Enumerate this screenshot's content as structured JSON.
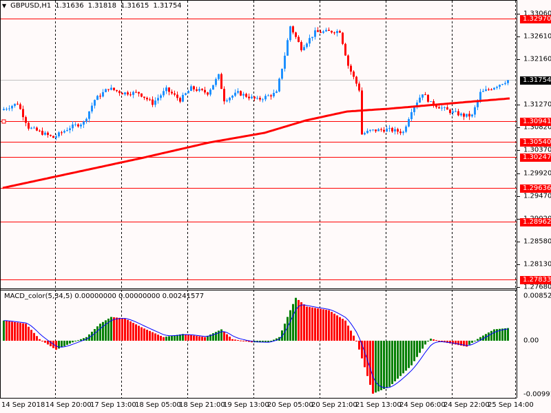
{
  "header": {
    "symbol": "GBPUSD,H1",
    "open": "1.31636",
    "high": "1.31818",
    "low": "1.31615",
    "close": "1.31754"
  },
  "macd_header": {
    "label": "MACD_color(5,34,5) 0.00000000 0.00000000 0.00241577"
  },
  "colors": {
    "up": "#1e90ff",
    "down": "#ff0000",
    "ma": "#ff0000",
    "level": "#ff0000",
    "macd_up": "#008000",
    "macd_down": "#ff0000",
    "signal": "#0000ff",
    "bid": "#c0c0c0"
  },
  "price_axis": [
    "1.33060",
    "1.32610",
    "1.32160",
    "1.31270",
    "1.30820",
    "1.30370",
    "1.29920",
    "1.29470",
    "1.29020",
    "1.28580",
    "1.28130",
    "1.27680"
  ],
  "levels": [
    {
      "value": "1.32970"
    },
    {
      "value": "1.30941"
    },
    {
      "value": "1.30540"
    },
    {
      "value": "1.30247"
    },
    {
      "value": "1.29636"
    },
    {
      "value": "1.28962"
    },
    {
      "value": "1.27833"
    }
  ],
  "bid": {
    "value": "1.31754"
  },
  "macd_axis": {
    "max": "0.008525",
    "zero": "0.00",
    "min": "-0.009915"
  },
  "time_axis": [
    "14 Sep 2018",
    "14 Sep 20:00",
    "17 Sep 13:00",
    "18 Sep 05:00",
    "18 Sep 21:00",
    "19 Sep 13:00",
    "20 Sep 05:00",
    "20 Sep 21:00",
    "21 Sep 13:00",
    "24 Sep 06:00",
    "24 Sep 22:00",
    "25 Sep 14:00"
  ],
  "chart_data": {
    "type": "candlestick",
    "symbol": "GBPUSD",
    "timeframe": "H1",
    "ylim": [
      1.2768,
      1.3306
    ],
    "bars": 184,
    "close_keypoints": [
      [
        0,
        1.31163
      ],
      [
        6,
        1.31298
      ],
      [
        10,
        1.30824
      ],
      [
        19,
        1.30621
      ],
      [
        25,
        1.30824
      ],
      [
        30,
        1.30919
      ],
      [
        34,
        1.31366
      ],
      [
        39,
        1.31596
      ],
      [
        44,
        1.31502
      ],
      [
        50,
        1.31502
      ],
      [
        55,
        1.31298
      ],
      [
        60,
        1.31569
      ],
      [
        65,
        1.31366
      ],
      [
        69,
        1.31596
      ],
      [
        75,
        1.31502
      ],
      [
        79,
        1.3184
      ],
      [
        81,
        1.31366
      ],
      [
        86,
        1.31502
      ],
      [
        93,
        1.31366
      ],
      [
        100,
        1.31502
      ],
      [
        103,
        1.32247
      ],
      [
        105,
        1.32816
      ],
      [
        109,
        1.32382
      ],
      [
        114,
        1.32694
      ],
      [
        123,
        1.32721
      ],
      [
        126,
        1.32044
      ],
      [
        130,
        1.31569
      ],
      [
        131,
        1.30688
      ],
      [
        134,
        1.30756
      ],
      [
        140,
        1.30783
      ],
      [
        146,
        1.30729
      ],
      [
        149,
        1.31163
      ],
      [
        153,
        1.31502
      ],
      [
        156,
        1.31298
      ],
      [
        163,
        1.31136
      ],
      [
        168,
        1.31054
      ],
      [
        171,
        1.31054
      ],
      [
        174,
        1.31502
      ],
      [
        178,
        1.31596
      ],
      [
        184,
        1.31754
      ]
    ],
    "ma_keypoints": [
      [
        0,
        1.29631
      ],
      [
        50,
        1.30214
      ],
      [
        75,
        1.30526
      ],
      [
        95,
        1.30716
      ],
      [
        110,
        1.3096
      ],
      [
        125,
        1.31136
      ],
      [
        140,
        1.3119
      ],
      [
        163,
        1.31298
      ],
      [
        184,
        1.31393
      ]
    ],
    "macd": {
      "ylim": [
        -0.009915,
        0.008525
      ],
      "hist_keypoints": [
        [
          0,
          0.0039
        ],
        [
          8,
          0.0033
        ],
        [
          13,
          0.0003
        ],
        [
          19,
          -0.0017
        ],
        [
          25,
          -0.0003
        ],
        [
          30,
          0.0007
        ],
        [
          35,
          0.0033
        ],
        [
          39,
          0.0046
        ],
        [
          44,
          0.0043
        ],
        [
          50,
          0.0026
        ],
        [
          58,
          0.0007
        ],
        [
          65,
          0.0013
        ],
        [
          73,
          0.0007
        ],
        [
          79,
          0.0022
        ],
        [
          83,
          0.0003
        ],
        [
          90,
          -0.0003
        ],
        [
          96,
          -0.0003
        ],
        [
          100,
          0.0007
        ],
        [
          104,
          0.0059
        ],
        [
          106,
          0.0083
        ],
        [
          110,
          0.0066
        ],
        [
          118,
          0.0059
        ],
        [
          124,
          0.0039
        ],
        [
          128,
          0.0
        ],
        [
          130,
          -0.0033
        ],
        [
          134,
          -0.0099
        ],
        [
          140,
          -0.0086
        ],
        [
          148,
          -0.0046
        ],
        [
          153,
          -0.0007
        ],
        [
          155,
          0.0004
        ],
        [
          160,
          -0.0003
        ],
        [
          168,
          -0.0011
        ],
        [
          173,
          0.0007
        ],
        [
          178,
          0.0022
        ],
        [
          184,
          0.0025
        ]
      ]
    }
  }
}
